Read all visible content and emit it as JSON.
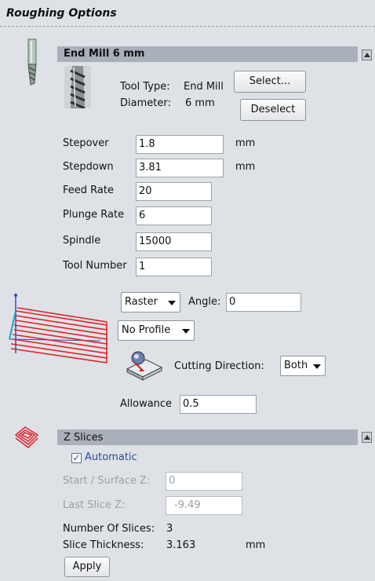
{
  "header": {
    "title": "Roughing Options"
  },
  "tool": {
    "section_title": "End Mill 6 mm",
    "type_label": "Tool Type:",
    "type_value": "End Mill",
    "diameter_label": "Diameter:",
    "diameter_value": "6 mm",
    "select_label": "Select...",
    "deselect_label": "Deselect"
  },
  "params": {
    "stepover": {
      "label": "Stepover",
      "value": "1.8",
      "unit": "mm"
    },
    "stepdown": {
      "label": "Stepdown",
      "value": "3.81",
      "unit": "mm"
    },
    "feed_rate": {
      "label": "Feed Rate",
      "value": "20"
    },
    "plunge_rate": {
      "label": "Plunge Rate",
      "value": "6"
    },
    "spindle": {
      "label": "Spindle",
      "value": "15000"
    },
    "tool_number": {
      "label": "Tool Number",
      "value": "1"
    }
  },
  "strategy": {
    "pattern": "Raster",
    "angle_label": "Angle:",
    "angle_value": "0",
    "profile": "No Profile",
    "cutting_direction_label": "Cutting Direction:",
    "cutting_direction": "Both",
    "allowance_label": "Allowance",
    "allowance_value": "0.5"
  },
  "zslices": {
    "section_title": "Z Slices",
    "automatic_label": "Automatic",
    "automatic_checked": true,
    "start_label": "Start / Surface Z:",
    "start_value": "0",
    "last_label": "Last Slice Z:",
    "last_value": "-9.49",
    "num_slices_label": "Number Of Slices:",
    "num_slices_value": "3",
    "thickness_label": "Slice Thickness:",
    "thickness_value": "3.163",
    "thickness_unit": "mm",
    "apply_label": "Apply"
  },
  "colors": {
    "raster_lines": "#e0202a",
    "accent_blue": "#2a4c9c",
    "section_bar": "#a9b0b9"
  }
}
